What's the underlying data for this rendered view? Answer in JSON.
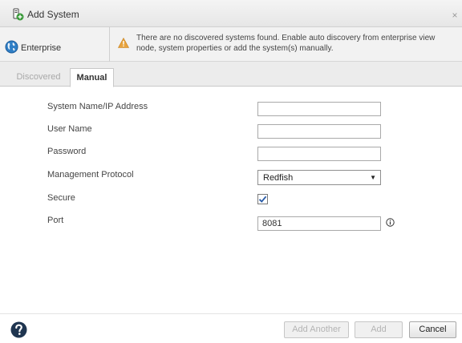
{
  "dialog": {
    "title": "Add System",
    "close_glyph": "×",
    "icon": "add-system-icon"
  },
  "context": {
    "scope_label": "Enterprise",
    "scope_icon": "globe-icon",
    "warning_icon": "warning-icon",
    "warning_text": "There are no discovered systems found. Enable auto discovery from enterprise view node, system properties or add the system(s) manually."
  },
  "tabs": [
    {
      "label": "Discovered",
      "active": false
    },
    {
      "label": "Manual",
      "active": true
    }
  ],
  "form": {
    "system_name": {
      "label": "System Name/IP Address",
      "value": ""
    },
    "user_name": {
      "label": "User Name",
      "value": ""
    },
    "password": {
      "label": "Password",
      "value": ""
    },
    "protocol": {
      "label": "Management Protocol",
      "value": "Redfish",
      "arrow": "▼"
    },
    "secure": {
      "label": "Secure",
      "checked": true
    },
    "port": {
      "label": "Port",
      "value": "8081",
      "info_icon": "info-icon"
    }
  },
  "footer": {
    "help_icon": "help-icon",
    "add_another_label": "Add Another",
    "add_label": "Add",
    "cancel_label": "Cancel"
  },
  "colors": {
    "warning": "#e8a33d",
    "help": "#1f3550",
    "check": "#2a5ca8",
    "globe": "#2f7fc6"
  }
}
